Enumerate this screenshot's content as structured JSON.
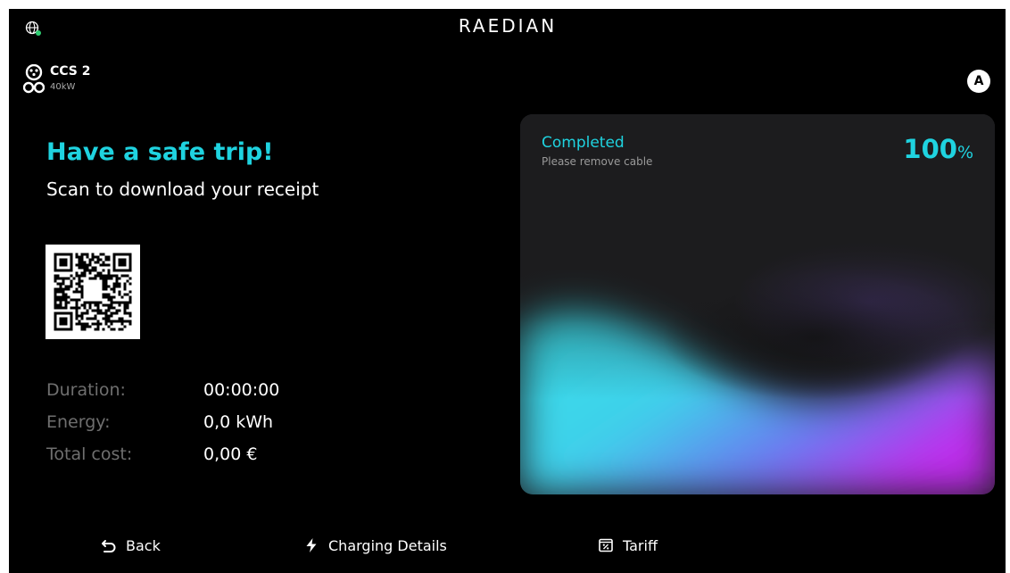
{
  "header": {
    "brand": "RAEDIAN",
    "globe_icon": "globe-icon"
  },
  "connector": {
    "name": "CCS 2",
    "power": "40kW",
    "icon": "ccs2-connector-icon"
  },
  "user": {
    "avatar_initial": "A"
  },
  "main": {
    "headline": "Have a safe trip!",
    "subline": "Scan to download your receipt",
    "qr_icon": "receipt-qr-code",
    "stats": [
      {
        "label": "Duration:",
        "value": "00:00:00"
      },
      {
        "label": "Energy:",
        "value": "0,0 kWh"
      },
      {
        "label": "Total cost:",
        "value": "0,00 €"
      }
    ]
  },
  "charge_card": {
    "status": "Completed",
    "hint": "Please remove cable",
    "percent_value": "100",
    "percent_unit": "%",
    "level": 1.0,
    "colors": {
      "cyan": "#36e0ea",
      "blue": "#5a8cf0",
      "purple": "#b830e8"
    }
  },
  "nav": {
    "back_label": "Back",
    "details_label": "Charging Details",
    "tariff_label": "Tariff"
  },
  "colors": {
    "accent": "#1fd3e0",
    "background": "#000000",
    "muted": "#6f6f6f"
  }
}
